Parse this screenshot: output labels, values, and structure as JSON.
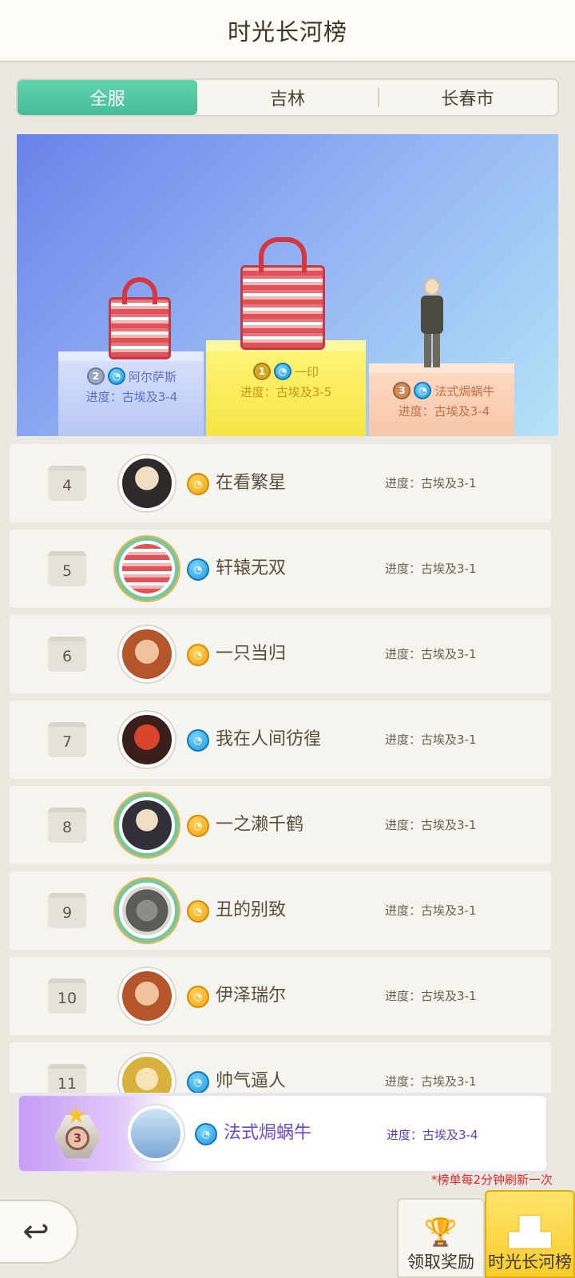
{
  "header": {
    "title": "时光长河榜"
  },
  "tabs": [
    {
      "label": "全服",
      "active": true
    },
    {
      "label": "吉林",
      "active": false
    },
    {
      "label": "长春市",
      "active": false
    }
  ],
  "podium": {
    "first": {
      "rank": "1",
      "name": "一印",
      "progress": "进度：古埃及3-5",
      "class_icon": "blue"
    },
    "second": {
      "rank": "2",
      "name": "阿尔萨斯",
      "progress": "进度：古埃及3-4",
      "class_icon": "blue"
    },
    "third": {
      "rank": "3",
      "name": "法式焗蜗牛",
      "progress": "进度：古埃及3-4",
      "class_icon": "blue"
    }
  },
  "list": [
    {
      "rank": "4",
      "name": "在看繁星",
      "progress": "进度：古埃及3-1",
      "class_icon": "orange",
      "framed": false,
      "avatar_color": "#2f2a2a"
    },
    {
      "rank": "5",
      "name": "轩辕无双",
      "progress": "进度：古埃及3-1",
      "class_icon": "blue",
      "framed": true,
      "avatar_color": "#e05a5f"
    },
    {
      "rank": "6",
      "name": "一只当归",
      "progress": "进度：古埃及3-1",
      "class_icon": "orange",
      "framed": false,
      "avatar_color": "#b5552b"
    },
    {
      "rank": "7",
      "name": "我在人间彷徨",
      "progress": "进度：古埃及3-1",
      "class_icon": "blue",
      "framed": false,
      "avatar_color": "#a22a1c"
    },
    {
      "rank": "8",
      "name": "一之濑千鹤",
      "progress": "进度：古埃及3-1",
      "class_icon": "orange",
      "framed": true,
      "avatar_color": "#303038"
    },
    {
      "rank": "9",
      "name": "丑的别致",
      "progress": "进度：古埃及3-1",
      "class_icon": "orange",
      "framed": true,
      "avatar_color": "#5b5b58"
    },
    {
      "rank": "10",
      "name": "伊泽瑞尔",
      "progress": "进度：古埃及3-1",
      "class_icon": "orange",
      "framed": false,
      "avatar_color": "#b5552b"
    },
    {
      "rank": "11",
      "name": "帅气逼人",
      "progress": "进度：古埃及3-1",
      "class_icon": "blue",
      "framed": false,
      "avatar_color": "#d9b23d"
    }
  ],
  "my_rank": {
    "rank": "3",
    "name": "法式焗蜗牛",
    "progress": "进度：古埃及3-4",
    "class_icon": "blue"
  },
  "note": "*榜单每2分钟刷新一次",
  "buttons": {
    "reward": "领取奖励",
    "ranks": "时光长河榜"
  },
  "icons": {
    "back": "back-arrow-icon",
    "reward": "trophy-icon",
    "ranks": "podium-icon",
    "class_blue": "blue-class-icon",
    "class_orange": "orange-class-icon"
  },
  "colors": {
    "accent": "#45bd98",
    "highlight": "#f8cd2c",
    "note": "#e02a2a"
  }
}
